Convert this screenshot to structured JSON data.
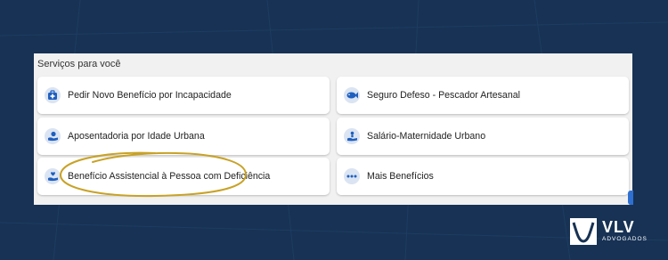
{
  "section_title": "Serviços para você",
  "services": [
    {
      "label": "Pedir Novo Benefício por Incapacidade",
      "icon": "medical-kit-icon"
    },
    {
      "label": "Seguro Defeso - Pescador Artesanal",
      "icon": "fish-icon"
    },
    {
      "label": "Aposentadoria por Idade Urbana",
      "icon": "hand-coin-icon"
    },
    {
      "label": "Salário-Maternidade Urbano",
      "icon": "baby-hand-icon"
    },
    {
      "label": "Benefício Assistencial à Pessoa com Deficiência",
      "icon": "hand-person-icon"
    },
    {
      "label": "Mais Benefícios",
      "icon": "more-dots-icon"
    }
  ],
  "logo": {
    "name": "VLV",
    "subtitle": "ADVOGADOS"
  },
  "colors": {
    "background": "#173254",
    "card": "#f1f1f1",
    "icon_circle": "#dbe4f2",
    "icon_fg": "#1f5fbf",
    "highlight": "#c8a227"
  }
}
